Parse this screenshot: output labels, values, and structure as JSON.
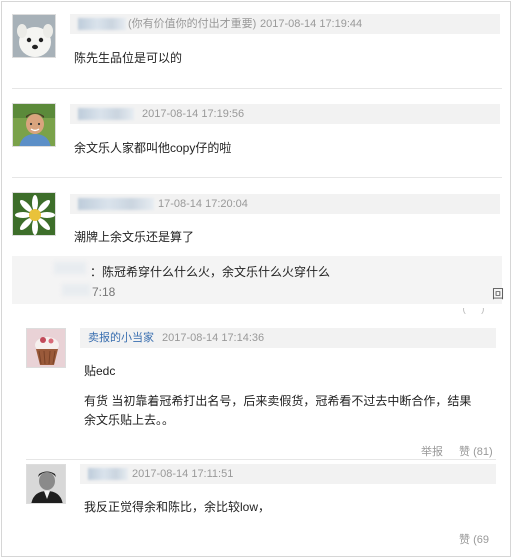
{
  "comments": [
    {
      "name_suffix": "(你有价值你的付出才重要)",
      "time": "2017-08-14 17:19:44",
      "body": "陈先生品位是可以的"
    },
    {
      "time": "2017-08-14 17:19:56",
      "body": "余文乐人家都叫他copy仔的啦"
    },
    {
      "time_partial": "17-08-14 17:20:04",
      "body": "潮牌上余文乐还是算了",
      "reply": {
        "body": "：陈冠希穿什么什么火，余文乐什么火穿什么",
        "time_partial": "7:18",
        "edge_icon": "回"
      }
    }
  ],
  "replies": [
    {
      "name": "卖报的小当家",
      "time": "2017-08-14 17:14:36",
      "line1": "贴edc",
      "line2": "有货 当初靠着冠希打出名号，后来卖假货，冠希看不过去中断合作，结果余文乐贴上去。。",
      "report": "举报",
      "like": "赞",
      "like_count": "(81)"
    },
    {
      "time": "2017-08-14 17:11:51",
      "body": "我反正觉得余和陈比，余比较low，",
      "like": "赞",
      "like_count_partial": "(69"
    }
  ],
  "icons": [
    "dog-avatar",
    "man-avatar",
    "daisy-avatar",
    "cupcake-avatar",
    "bw-portrait-avatar"
  ]
}
